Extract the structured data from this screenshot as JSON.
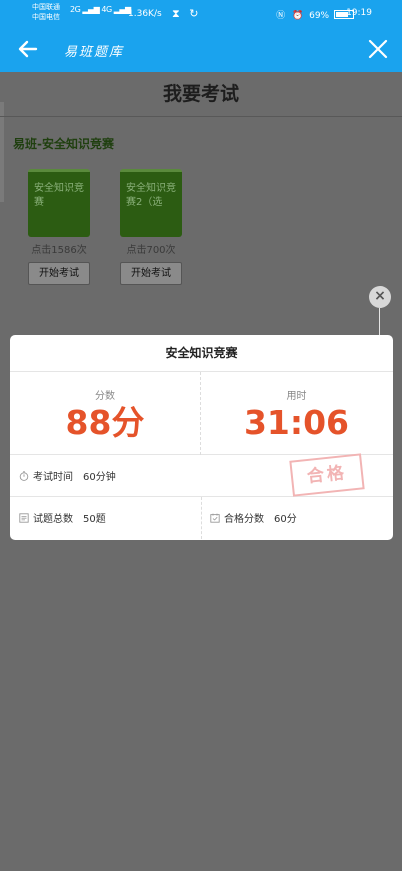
{
  "status_bar": {
    "carrier1": "中国联通",
    "carrier2": "中国电信",
    "net1": "2G",
    "net2": "4G",
    "speed": "1.36K/s",
    "battery": "69%",
    "time": "19:19"
  },
  "app_bar": {
    "title": "易班题库"
  },
  "page": {
    "title": "我要考试",
    "section": "易班-安全知识竞赛",
    "cards": [
      {
        "cover_text": "安全知识竞赛",
        "clicks": "点击1586次",
        "button": "开始考试"
      },
      {
        "cover_text": "安全知识竞赛2（选",
        "clicks": "点击700次",
        "button": "开始考试"
      }
    ]
  },
  "modal": {
    "close_label": "×",
    "title": "安全知识竞赛",
    "score_label": "分数",
    "score_value": "88分",
    "time_label": "用时",
    "time_value": "31:06",
    "exam_time_label": "考试时间",
    "exam_time_value": "60分钟",
    "stamp": "合格",
    "total_label": "试题总数",
    "total_value": "50题",
    "pass_label": "合格分数",
    "pass_value": "60分"
  },
  "colors": {
    "accent": "#1aa3ee",
    "score": "#e5532a",
    "stamp": "#f2b4b4"
  }
}
